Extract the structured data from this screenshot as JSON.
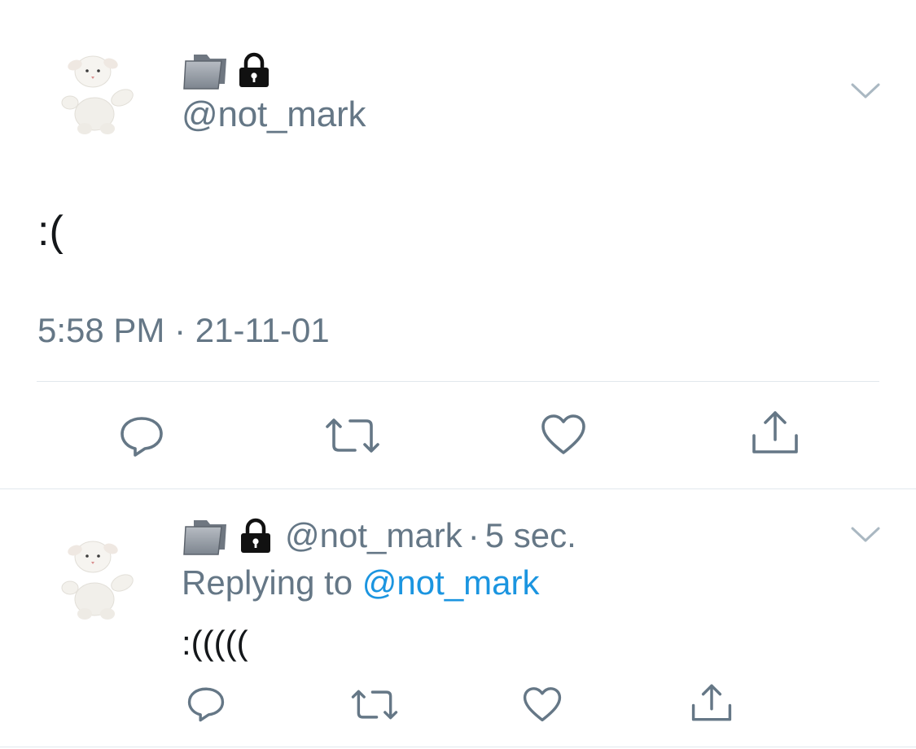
{
  "main_tweet": {
    "author": {
      "avatar_icon": "lamb-plush-avatar",
      "name_emojis": [
        "file-folder-icon",
        "lock-icon"
      ],
      "handle": "@not_mark"
    },
    "text": ":(",
    "timestamp": "5:58 PM · 21-11-01",
    "menu_icon": "chevron-down-icon",
    "actions": [
      "reply-icon",
      "retweet-icon",
      "like-icon",
      "share-icon"
    ]
  },
  "reply_tweet": {
    "author": {
      "avatar_icon": "lamb-plush-avatar",
      "name_emojis": [
        "file-folder-icon",
        "lock-icon"
      ],
      "handle": "@not_mark",
      "separator": "·",
      "time": "5 sec."
    },
    "replying_prefix": "Replying to",
    "replying_to": "@not_mark",
    "text": ":(((((",
    "menu_icon": "chevron-down-icon",
    "actions": [
      "reply-icon",
      "retweet-icon",
      "like-icon",
      "share-icon"
    ]
  },
  "colors": {
    "muted": "#657786",
    "link": "#1b95e0",
    "divider": "#e1e8ed",
    "text": "#14171a"
  }
}
